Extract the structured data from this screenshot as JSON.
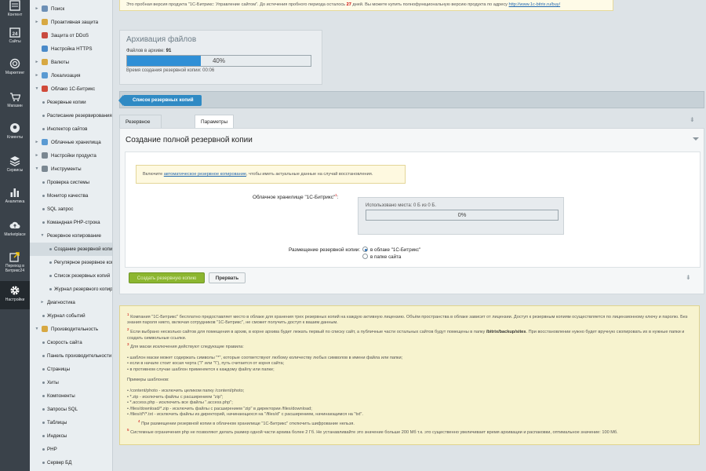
{
  "iconbar": {
    "items": [
      {
        "label": "Контент",
        "icon": "content-icon"
      },
      {
        "label": "Сайты",
        "icon": "calendar-icon"
      },
      {
        "label": "Маркетинг",
        "icon": "target-icon"
      },
      {
        "label": "Магазин",
        "icon": "cart-icon"
      },
      {
        "label": "Клиенты",
        "icon": "chat-icon"
      },
      {
        "label": "Сервисы",
        "icon": "layers-icon"
      },
      {
        "label": "Аналитика",
        "icon": "bar-chart-icon"
      },
      {
        "label": "Marketplace",
        "icon": "cloud-upload-icon"
      },
      {
        "label": "Переход в Битрикс24",
        "icon": "transfer-icon"
      },
      {
        "label": "Настройки",
        "icon": "gear-icon"
      }
    ]
  },
  "menu": {
    "items": [
      {
        "label": "Поиск",
        "level": 0,
        "expand": "►",
        "icon_color": "#6c8fb5"
      },
      {
        "label": "Проактивная защита",
        "level": 0,
        "expand": "►",
        "icon_color": "#d7a842"
      },
      {
        "label": "Защита от DDoS",
        "level": 0,
        "expand": "",
        "icon_color": "#c94a3f"
      },
      {
        "label": "Настройка HTTPS",
        "level": 0,
        "expand": "",
        "icon_color": "#4a8ac9"
      },
      {
        "label": "Валюты",
        "level": 0,
        "expand": "►",
        "icon_color": "#d7a842"
      },
      {
        "label": "Локализация",
        "level": 0,
        "expand": "►",
        "icon_color": "#5a9ad2"
      },
      {
        "label": "Облако 1С-Битрикс",
        "level": 0,
        "expand": "▼",
        "icon_color": "#d04a3a"
      },
      {
        "label": "Резервные копии",
        "level": 1
      },
      {
        "label": "Расписание резервирования",
        "level": 1
      },
      {
        "label": "Инспектор сайтов",
        "level": 1
      },
      {
        "label": "Облачные хранилища",
        "level": 0,
        "expand": "►",
        "icon_color": "#5a9ad2"
      },
      {
        "label": "Настройки продукта",
        "level": 0,
        "expand": "►",
        "icon_color": "#7a8791"
      },
      {
        "label": "Инструменты",
        "level": 0,
        "expand": "▼",
        "icon_color": "#7a8791"
      },
      {
        "label": "Проверка системы",
        "level": 1
      },
      {
        "label": "Монитор качества",
        "level": 1
      },
      {
        "label": "SQL запрос",
        "level": 1
      },
      {
        "label": "Командная PHP-строка",
        "level": 1
      },
      {
        "label": "Резервное копирование",
        "level": 1,
        "expand": "▼"
      },
      {
        "label": "Создание резервной копии",
        "level": 2,
        "selected": true
      },
      {
        "label": "Регулярное резервное копирование",
        "level": 2
      },
      {
        "label": "Список резервных копий",
        "level": 2
      },
      {
        "label": "Журнал резервного копирования",
        "level": 2
      },
      {
        "label": "Диагностика",
        "level": 1,
        "expand": "►"
      },
      {
        "label": "Журнал событий",
        "level": 1
      },
      {
        "label": "Производительность",
        "level": 0,
        "expand": "▼",
        "icon_color": "#d7a842"
      },
      {
        "label": "Скорость сайта",
        "level": 1
      },
      {
        "label": "Панель производительности",
        "level": 1
      },
      {
        "label": "Страницы",
        "level": 1
      },
      {
        "label": "Хиты",
        "level": 1
      },
      {
        "label": "Компоненты",
        "level": 1
      },
      {
        "label": "Запросы SQL",
        "level": 1
      },
      {
        "label": "Таблицы",
        "level": 1
      },
      {
        "label": "Индексы",
        "level": 1
      },
      {
        "label": "PHP",
        "level": 1
      },
      {
        "label": "Сервер БД",
        "level": 1
      }
    ]
  },
  "trial": {
    "before": "Это пробная версия продукта \"1С-Битрикс: Управление сайтом\". До истечения пробного периода осталось ",
    "days": "27",
    "after": " дней. Вы можете купить полнофункциональную версию продукта по адресу ",
    "link": "http://www.1c-bitrix.ru/buy/"
  },
  "archive": {
    "title": "Архивация файлов",
    "files_label": "Файлов в архиве:",
    "files_count": "91",
    "progress": 0.4,
    "progress_text": "40%",
    "time_text": "Время создания резервной копии: 00:06"
  },
  "toolbar": {
    "backup_list_label": "Список резервных копий"
  },
  "tabs": {
    "backup_label": "Резервное копирование",
    "params_label": "Параметры"
  },
  "panel": {
    "title": "Создание полной резервной копии",
    "note_before": "Включите ",
    "note_link": "автоматическое резервное копирование",
    "note_after": ", чтобы иметь актуальные данные на случай восстановления.",
    "cloud_label": "Облачное хранилище \"1С-Битрикс\"",
    "cloud_sup": "1",
    "cloud_used": "Использовано места: 0 Б из 0 Б.",
    "cloud_progress": 0,
    "cloud_progress_text": "0%",
    "place_label": "Размещение резервной копии:",
    "radio_cloud": "в облаке \"1С-Битрикс\"",
    "radio_site": "в папке сайта",
    "create_button": "Создать резервную копию",
    "restore_button": "Прервать"
  },
  "footnotes": {
    "n1": "1",
    "t1": " Компания \"1С-Битрикс\" бесплатно предоставляет место в облаке для хранения трех резервных копий на каждую активную лицензию. Объём пространства в облаке зависит от лицензии. Доступ к резервным копиям осуществляется по лицензионному ключу и паролю. Без знания пароля никто, включая сотрудников \"1С-Битрикс\", не сможет получить доступ к вашим данным.",
    "n2": "2",
    "t2a": " Если выбрано несколько сайтов для помещения в архив, в корне архива будет лежать первый по списку сайт, а публичные части остальных сайтов будут помещены в папку ",
    "t2b": "/bitrix/backup/sites",
    "t2c": ". При восстановлении нужно будет вручную скопировать их в нужные папки и создать символьные ссылки.",
    "n3": "3",
    "t3": " Для маски исключения действуют следующие правила:",
    "rules": [
      "шаблон маски может содержать символы \"*\", которые соответствуют любому количеству любых символов в имени файла или папки;",
      "если в начале стоит косая черта (\"/\" или \"\\\"), путь считается от корня сайта;",
      "в противном случае шаблон применяется к каждому файлу или папке;"
    ],
    "examples_title": "Примеры шаблонов:",
    "examples": [
      "/content/photo - исключить целиком папку /content/photo;",
      "*.zip - исключить файлы с расширением \"zip\";",
      "*.access.php - исключить все файлы \".access.php\";",
      "/files/download/*.zip - исключить файлы с расширением \"zip\" в директории /files/download;",
      "/files/d*/*.txt - исключить файлы из директорий, начинающихся на \"/files/d\" с расширением, начинающимся на \"txt\"."
    ],
    "n4": "4",
    "t4": " При размещении резервной копии в облачном хранилище \"1С-Битрикс\" отключить шифрование нельзя.",
    "n5": "5",
    "t5": " Системные ограничения php не позволяют делать размер одной части архива более 2 Гб. Не устанавливайте это значение больше 200 Мб т.к. это существенно увеличивает время архивации и распаковки, оптимальное значение: 100 Мб."
  }
}
